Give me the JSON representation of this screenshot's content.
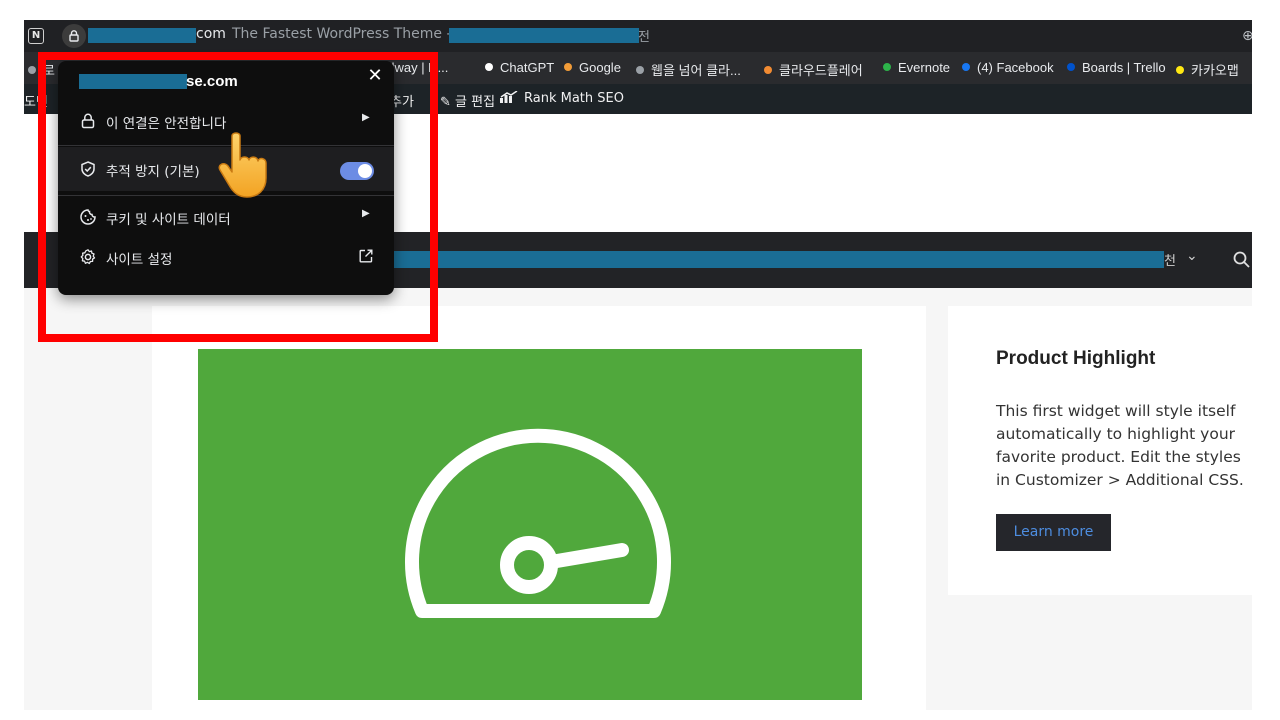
{
  "browser": {
    "app_icon": "notion-icon",
    "address": {
      "domain_suffix": "com",
      "title": "The Fastest WordPress Theme -",
      "title_tail": "전"
    },
    "bookmarks": [
      {
        "label": "udway | N...",
        "color": "#9aa0a6"
      },
      {
        "label": "ChatGPT",
        "color": "#ffffff"
      },
      {
        "label": "Google",
        "color": "#f29c38"
      },
      {
        "label": "웹을 넘어 클라...",
        "color": "#9aa0a6"
      },
      {
        "label": "클라우드플레어",
        "color": "#f28b32"
      },
      {
        "label": "Evernote",
        "color": "#2db34a"
      },
      {
        "label": "(4) Facebook",
        "color": "#1877f2"
      },
      {
        "label": "Boards | Trello",
        "color": "#0052cc"
      },
      {
        "label": "카카오맵",
        "color": "#ffe812"
      }
    ],
    "bookmarks_partial": "로",
    "adminbar": {
      "left_partial": "도민",
      "add_partial": "추가",
      "edit_post": "글 편집",
      "rank_math": "Rank Math SEO"
    }
  },
  "popup": {
    "domain": "se.com",
    "connection_label": "이 연결은 안전합니다",
    "tracking_label": "추적 방지 (기본)",
    "tracking_enabled": true,
    "cookies_label": "쿠키 및 사이트 데이터",
    "site_settings_label": "사이트 설정"
  },
  "site": {
    "nav": {
      "tail": "천"
    },
    "widget": {
      "title": "Product Highlight",
      "body": "This first widget will style itself automatically to highlight your favorite product. Edit the styles in Customizer > Additional CSS.",
      "button": "Learn more"
    }
  },
  "colors": {
    "featured_bg": "#50a83c",
    "highlight": "#ff0000",
    "toggle": "#6c8ce4",
    "redaction": "#1a6d95"
  }
}
